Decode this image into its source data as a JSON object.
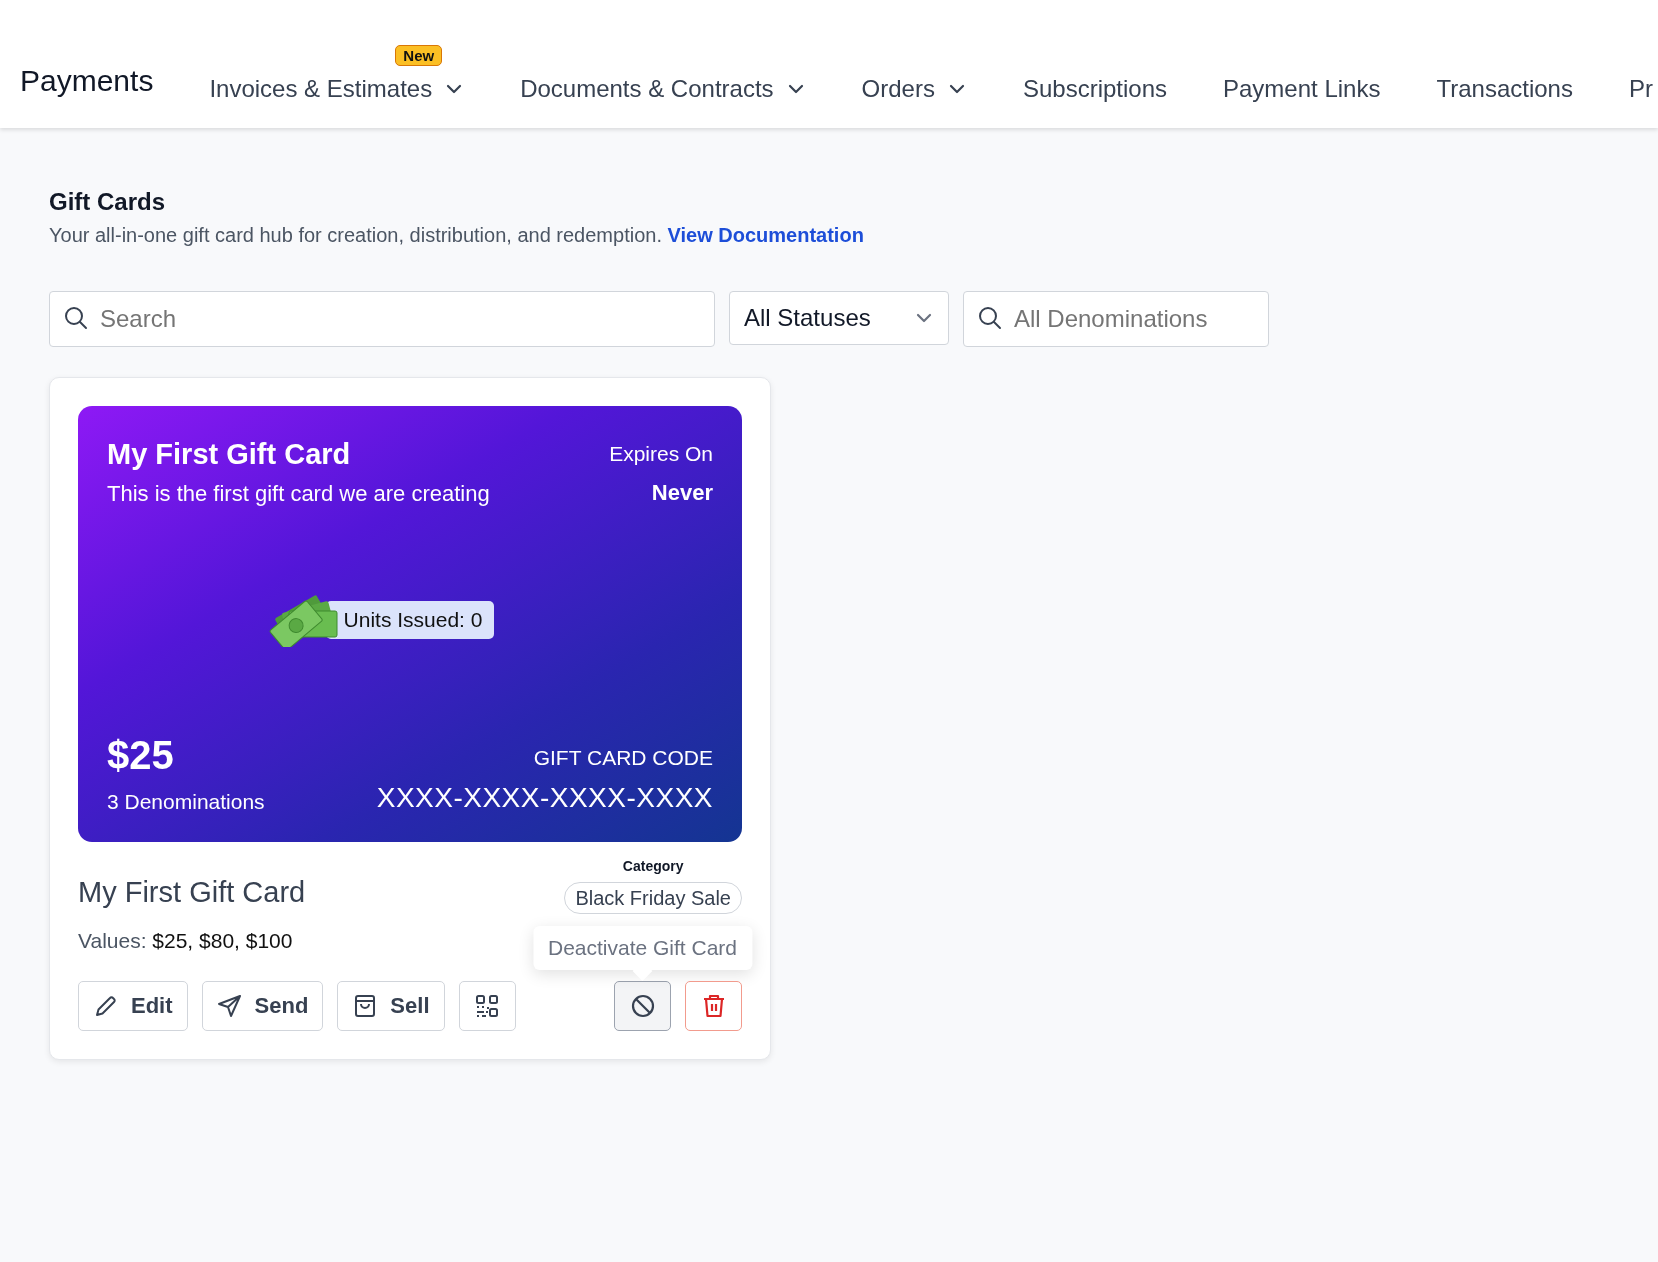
{
  "nav": {
    "title": "Payments",
    "items": [
      {
        "label": "Invoices & Estimates",
        "kind": "dropdown",
        "badge": "New"
      },
      {
        "label": "Documents & Contracts",
        "kind": "dropdown"
      },
      {
        "label": "Orders",
        "kind": "dropdown"
      },
      {
        "label": "Subscriptions",
        "kind": "link"
      },
      {
        "label": "Payment Links",
        "kind": "link"
      },
      {
        "label": "Transactions",
        "kind": "link"
      },
      {
        "label": "Pr",
        "kind": "link"
      }
    ]
  },
  "page": {
    "title": "Gift Cards",
    "description": "Your all-in-one gift card hub for creation, distribution, and redemption.",
    "link": "View Documentation"
  },
  "filters": {
    "search": {
      "placeholder": "Search"
    },
    "status": {
      "value": "All Statuses"
    },
    "denominations": {
      "placeholder": "All Denominations"
    }
  },
  "gift_cards": [
    {
      "card": {
        "title": "My First Gift Card",
        "subtitle": "This is the first gift card we are creating",
        "expires_label": "Expires On",
        "expires_value": "Never",
        "units_issued": "Units Issued: 0",
        "amount": "$25",
        "denominations": "3 Denominations",
        "code_label": "GIFT CARD CODE",
        "code": "XXXX-XXXX-XXXX-XXXX"
      },
      "name": "My First Gift Card",
      "values_label": "Values:",
      "values": "$25, $80, $100",
      "category_label": "Category",
      "category": "Black Friday Sale",
      "actions": [
        {
          "kind": "edit",
          "label": "Edit",
          "hovered": false
        },
        {
          "kind": "send",
          "label": "Send",
          "hovered": false
        },
        {
          "kind": "sell",
          "label": "Sell",
          "hovered": false
        },
        {
          "kind": "qr",
          "hovered": false
        },
        {
          "kind": "deactivate",
          "hovered": true,
          "tooltip": "Deactivate Gift Card"
        },
        {
          "kind": "delete",
          "hovered": false
        }
      ]
    }
  ]
}
